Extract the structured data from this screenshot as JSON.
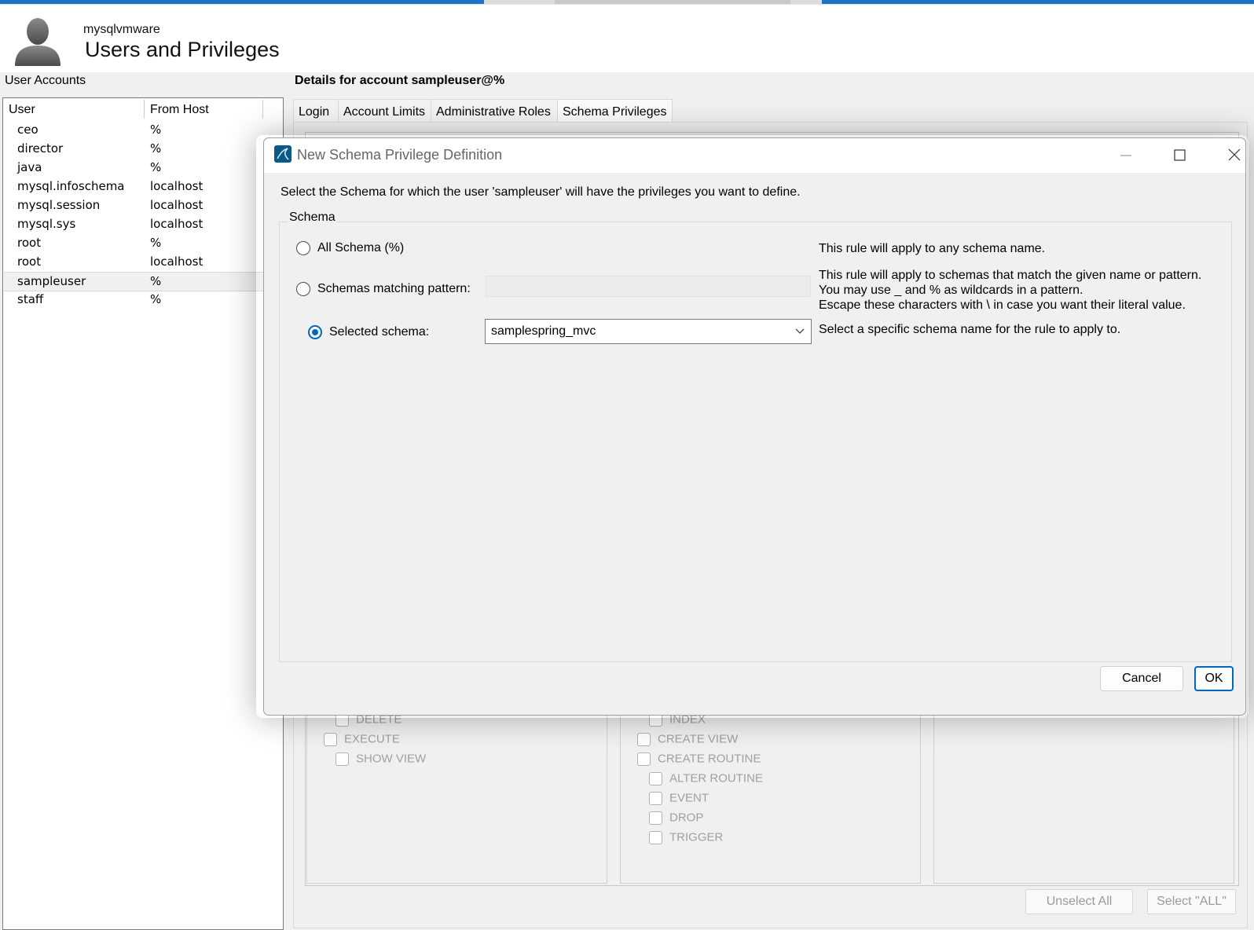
{
  "header": {
    "app_name": "mysqlvmware",
    "title": "Users and Privileges"
  },
  "user_accounts": {
    "label": "User Accounts",
    "columns": [
      "User",
      "From Host"
    ],
    "rows": [
      {
        "user": "ceo",
        "host": "%"
      },
      {
        "user": "director",
        "host": "%"
      },
      {
        "user": "java",
        "host": "%"
      },
      {
        "user": "mysql.infoschema",
        "host": "localhost"
      },
      {
        "user": "mysql.session",
        "host": "localhost"
      },
      {
        "user": "mysql.sys",
        "host": "localhost"
      },
      {
        "user": "root",
        "host": "%"
      },
      {
        "user": "root",
        "host": "localhost"
      },
      {
        "user": "sampleuser",
        "host": "%"
      },
      {
        "user": "staff",
        "host": "%"
      }
    ],
    "selected_index": 8
  },
  "details": {
    "title": "Details for account sampleuser@%",
    "tabs": [
      "Login",
      "Account Limits",
      "Administrative Roles",
      "Schema Privileges"
    ],
    "active_tab": "Schema Privileges",
    "privileges_col1": [
      "DELETE",
      "EXECUTE",
      "SHOW VIEW"
    ],
    "privileges_col2": [
      "INDEX",
      "CREATE VIEW",
      "CREATE ROUTINE",
      "ALTER ROUTINE",
      "EVENT",
      "DROP",
      "TRIGGER"
    ],
    "unselect_all": "Unselect All",
    "select_all": "Select \"ALL\""
  },
  "dialog": {
    "title": "New Schema Privilege Definition",
    "prompt": "Select the Schema for which the user 'sampleuser' will have the privileges you want to define.",
    "group_label": "Schema",
    "options": {
      "all": {
        "label": "All Schema (%)",
        "description": "This rule will apply to any schema name."
      },
      "pattern": {
        "label": "Schemas matching pattern:",
        "value": "",
        "description_lines": [
          "This rule will apply to schemas that match the given name or pattern.",
          "You may use _ and % as wildcards in a pattern.",
          "Escape these characters with \\ in case you want their literal value."
        ]
      },
      "selected": {
        "label": "Selected schema:",
        "value": "samplespring_mvc",
        "description": "Select a specific schema name for the rule to apply to."
      }
    },
    "selected_option": "selected",
    "cancel_label": "Cancel",
    "ok_label": "OK"
  },
  "colors": {
    "accent": "#0067c0",
    "topbar": "#1a73c8",
    "disabled_text": "#a0a0a0"
  }
}
